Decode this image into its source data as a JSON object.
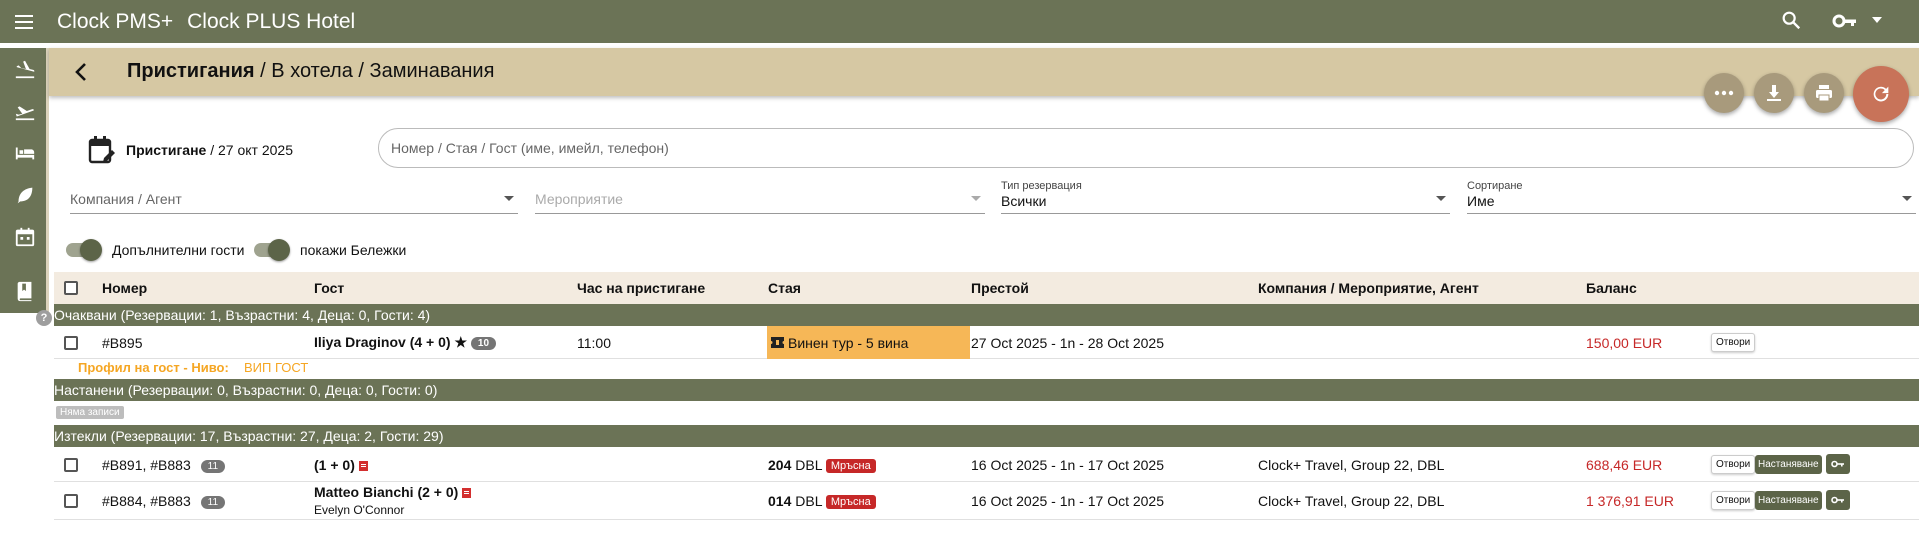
{
  "app": {
    "brand": "Clock PMS+",
    "hotel": "Clock PLUS Hotel"
  },
  "colors": {
    "primary": "#6b7356",
    "header": "#d6c8a3",
    "accent": "#c87359",
    "highlight": "#f6b757",
    "balance": "#c62828"
  },
  "sidebar": {
    "icons": [
      "flight-land-icon",
      "flight-takeoff-icon",
      "bed-icon",
      "leaf-icon",
      "calendar-icon",
      "book-icon"
    ],
    "help": "?"
  },
  "header": {
    "title": "Пристигания",
    "crumb2": "В хотела",
    "crumb3": "Заминавания",
    "sep": "/"
  },
  "date": {
    "label": "Пристигане",
    "value": "/ 27 окт 2025"
  },
  "search": {
    "placeholder": "Номер / Стая / Гост (име, имейл, телефон)"
  },
  "filters": {
    "company": {
      "placeholder": "Компания / Агент"
    },
    "event": {
      "placeholder": "Мероприятие"
    },
    "res_type": {
      "label": "Тип резервация",
      "value": "Всички"
    },
    "sort": {
      "label": "Сортиране",
      "value": "Име"
    }
  },
  "toggles": {
    "extra_guests": "Допълнителни гости",
    "show_notes": "покажи Бележки"
  },
  "columns": {
    "number": "Номер",
    "guest": "Гост",
    "arrival": "Час на пристигане",
    "room": "Стая",
    "stay": "Престой",
    "company": "Компания / Мероприятие, Агент",
    "balance": "Баланс"
  },
  "groups": {
    "expected": "Очаквани (Резервации: 1, Възрастни: 4, Деца: 0, Гости: 4)",
    "checked_in": "Настанени (Резервации: 0, Възрастни: 0, Деца: 0, Гости: 0)",
    "no_records": "Няма записи",
    "expired": "Изтекли (Резервации: 17, Възрастни: 27, Деца: 2, Гости: 29)"
  },
  "rows": {
    "r1": {
      "number": "#B895",
      "guest": "Iliya Draginov (4 + 0)",
      "star": "★",
      "loyalty": "10",
      "arrival": "11:00",
      "room": "Винен тур - 5 вина",
      "stay": "27 Oct 2025 - 1n - 28 Oct 2025",
      "balance": "150,00 EUR",
      "open": "Отвори",
      "profile_label": "Профил на гост - Ниво:",
      "profile_value": "ВИП ГОСТ"
    },
    "r2": {
      "number": "#B891, #B883",
      "count": "11",
      "guest": "(1 + 0)",
      "room_no": "204",
      "room_type": "DBL",
      "status": "Мръсна",
      "stay": "16 Oct 2025 - 1n - 17 Oct 2025",
      "company": "Clock+ Travel, Group 22, DBL",
      "balance": "688,46 EUR",
      "open": "Отвори",
      "checkin": "Настаняване"
    },
    "r3": {
      "number": "#B884, #B883",
      "count": "11",
      "guest": "Matteo Bianchi (2 + 0)",
      "guest2": "Evelyn O'Connor",
      "room_no": "014",
      "room_type": "DBL",
      "status": "Мръсна",
      "stay": "16 Oct 2025 - 1n - 17 Oct 2025",
      "company": "Clock+ Travel, Group 22, DBL",
      "balance": "1 376,91 EUR",
      "open": "Отвори",
      "checkin": "Настаняване"
    }
  }
}
